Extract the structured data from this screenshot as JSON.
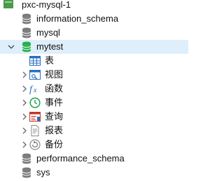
{
  "tree": {
    "connection": {
      "label": "pxc-mysql-1"
    },
    "databases": [
      {
        "label": "information_schema"
      },
      {
        "label": "mysql"
      },
      {
        "label": "mytest",
        "expanded": true,
        "children": [
          {
            "label": "表",
            "icon": "table-icon"
          },
          {
            "label": "视图",
            "icon": "view-icon"
          },
          {
            "label": "函数",
            "icon": "function-icon"
          },
          {
            "label": "事件",
            "icon": "event-clock-icon"
          },
          {
            "label": "查询",
            "icon": "query-icon"
          },
          {
            "label": "报表",
            "icon": "report-icon"
          },
          {
            "label": "备份",
            "icon": "backup-icon"
          }
        ]
      },
      {
        "label": "performance_schema"
      },
      {
        "label": "sys"
      }
    ]
  },
  "colors": {
    "selected_row": "#dfeefb",
    "db_active": "#23b14d",
    "db_inactive": "#7a7a7a"
  }
}
